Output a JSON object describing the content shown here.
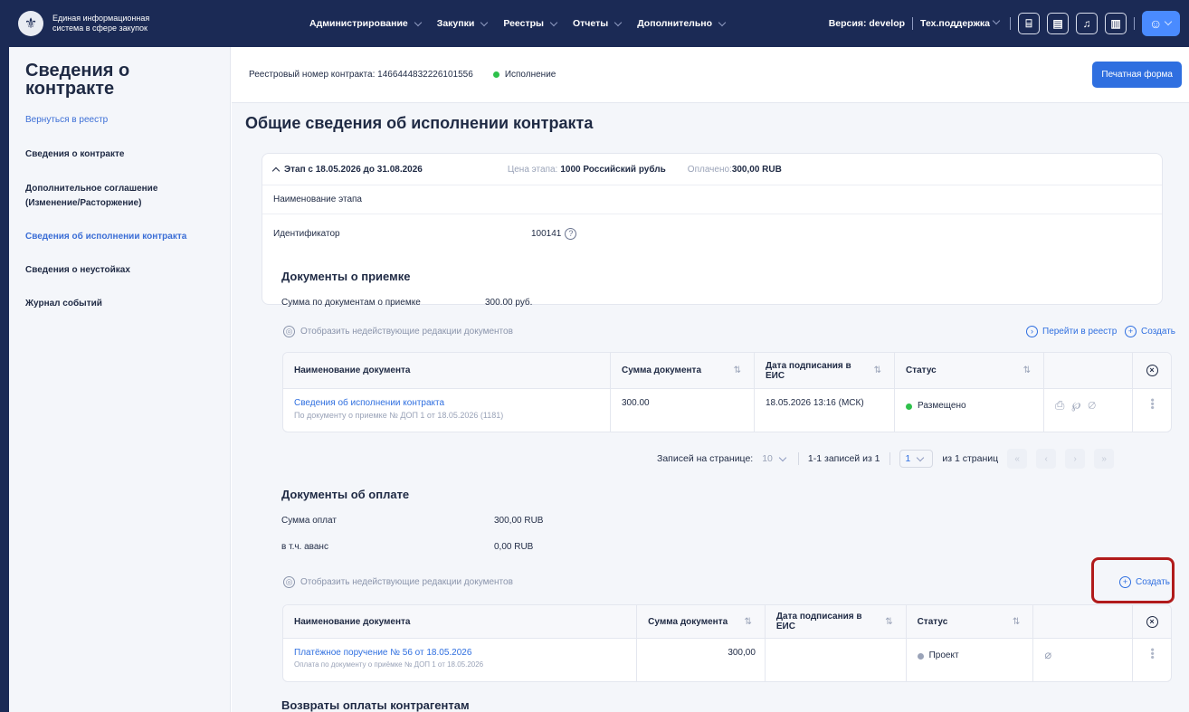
{
  "topbar": {
    "logo_line1": "Единая информационная",
    "logo_line2": "система в сфере закупок",
    "nav": [
      "Администрирование",
      "Закупки",
      "Реестры",
      "Отчеты",
      "Дополнительно"
    ],
    "version": "Версия: develop",
    "support": "Тех.поддержка"
  },
  "sidebar": {
    "title": "Сведения о контракте",
    "back": "Вернуться в реестр",
    "items": [
      {
        "label": "Сведения о контракте"
      },
      {
        "label": "Дополнительное соглашение (Изменение/Расторжение)"
      },
      {
        "label": "Сведения об исполнении контракта"
      },
      {
        "label": "Сведения о неустойках"
      },
      {
        "label": "Журнал событий"
      }
    ]
  },
  "header": {
    "registry": "Реестровый номер контракта: 1466444832226101556",
    "status": "Исполнение",
    "status_color": "#2ec14b",
    "print_button": "Печатная форма"
  },
  "page_title": "Общие сведения об исполнении контракта",
  "stage": {
    "title": "Этап с 18.05.2026 до 31.08.2026",
    "price_label": "Цена этапа:",
    "price_value": "1000 Российский рубль",
    "paid_label": "Оплачено:",
    "paid_value": "300,00 RUB",
    "name_label": "Наименование этапа",
    "id_label": "Идентификатор",
    "id_value": "100141"
  },
  "acceptance": {
    "title": "Документы о приемке",
    "sum_label": "Сумма по документам о приемке",
    "sum_value": "300.00 руб.",
    "show_inactive": "Отобразить недействующие редакции документов",
    "goto_registry": "Перейти в реестр",
    "create": "Создать",
    "columns": [
      "Наименование документа",
      "Сумма документа",
      "Дата подписания в ЕИС",
      "Статус"
    ],
    "row": {
      "name": "Сведения об исполнении контракта",
      "sub": "По документу о приемке № ДОП 1 от 18.05.2026 (1181)",
      "sum": "300.00",
      "date": "18.05.2026 13:16 (МСК)",
      "status": "Размещено",
      "status_color": "#2ec14b"
    },
    "pager": {
      "per_page_label": "Записей на странице:",
      "per_page": "10",
      "range": "1-1 записей из 1",
      "page": "1",
      "of_pages": "из 1 страниц"
    }
  },
  "payment": {
    "title": "Документы об оплате",
    "sum_label": "Сумма оплат",
    "sum_value": "300,00 RUB",
    "advance_label": "в т.ч. аванс",
    "advance_value": "0,00 RUB",
    "show_inactive": "Отобразить недействующие редакции документов",
    "create": "Создать",
    "columns": [
      "Наименование документа",
      "Сумма документа",
      "Дата подписания в ЕИС",
      "Статус"
    ],
    "row": {
      "name": "Платёжное поручение № 56 от 18.05.2026",
      "sub": "Оплата по документу о приёмке № ДОП 1 от 18.05.2026",
      "sum": "300,00",
      "date": "",
      "status": "Проект",
      "status_color": "#9aa3b8"
    }
  },
  "refunds_title": "Возвраты оплаты контрагентам"
}
